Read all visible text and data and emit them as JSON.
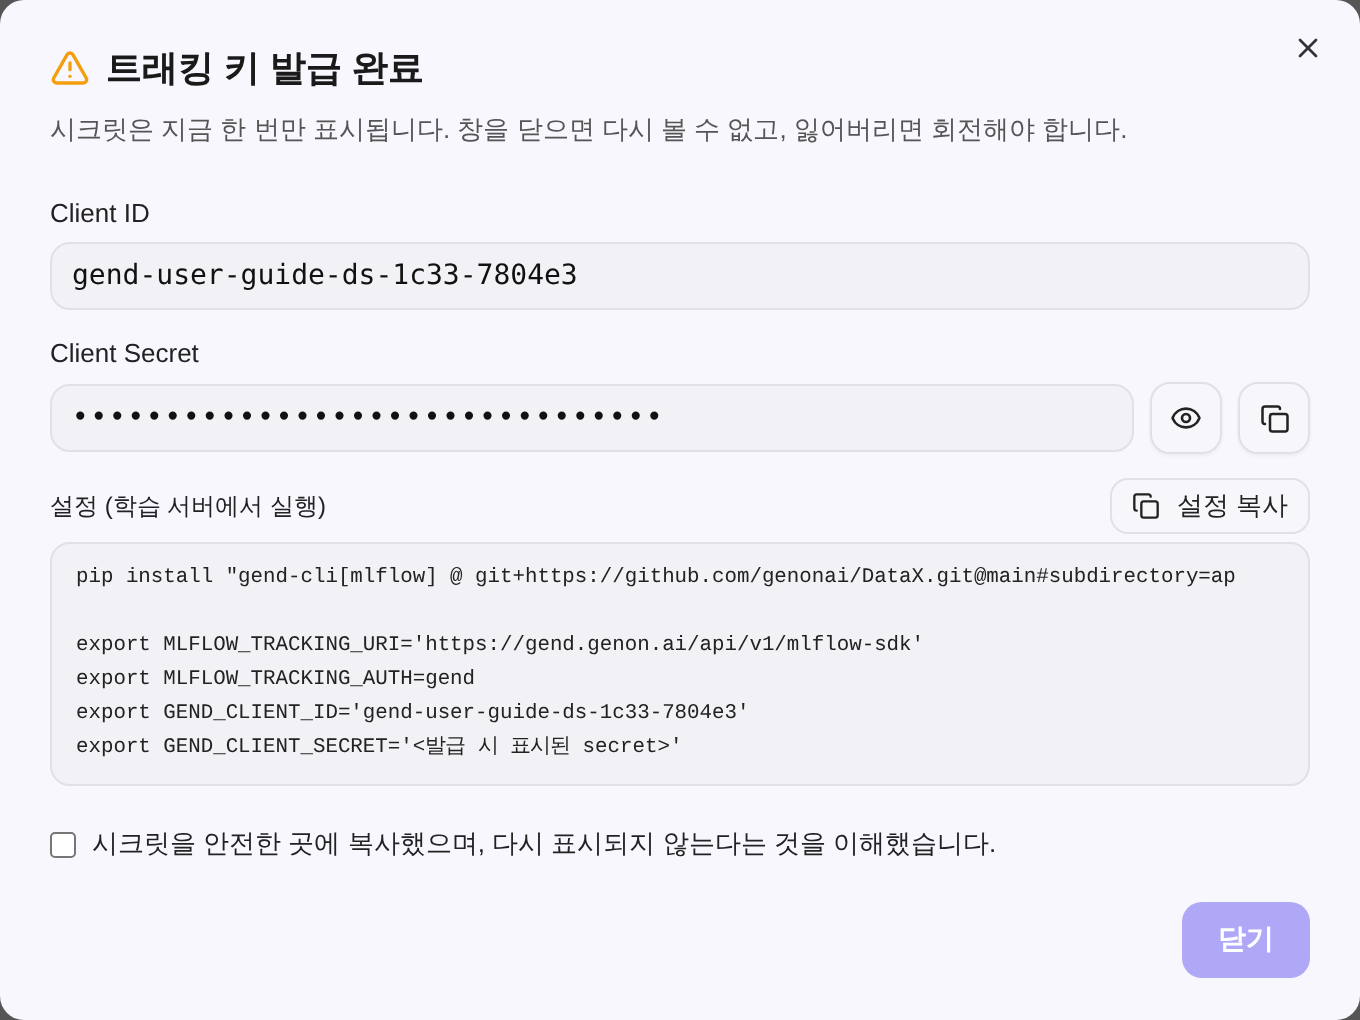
{
  "dialog": {
    "title": "트래킹 키 발급 완료",
    "description": "시크릿은 지금 한 번만 표시됩니다. 창을 닫으면 다시 볼 수 없고, 잃어버리면 회전해야 합니다."
  },
  "client_id": {
    "label": "Client ID",
    "value": "gend-user-guide-ds-1c33-7804e3"
  },
  "client_secret": {
    "label": "Client Secret",
    "value": "••••••••••••••••••••••••••••••••"
  },
  "setup": {
    "label": "설정 (학습 서버에서 실행)",
    "copy_button": "설정 복사",
    "install_line": "pip install \"gend-cli[mlflow] @ git+https://github.com/genonai/DataX.git@main#subdirectory=ap",
    "export_lines": [
      "export MLFLOW_TRACKING_URI='https://gend.genon.ai/api/v1/mlflow-sdk'",
      "export MLFLOW_TRACKING_AUTH=gend",
      "export GEND_CLIENT_ID='gend-user-guide-ds-1c33-7804e3'",
      "export GEND_CLIENT_SECRET='<발급 시 표시된 secret>'"
    ]
  },
  "confirm": {
    "label": "시크릿을 안전한 곳에 복사했으며, 다시 표시되지 않는다는 것을 이해했습니다.",
    "checked": false
  },
  "close_button": {
    "label": "닫기",
    "disabled": true
  }
}
